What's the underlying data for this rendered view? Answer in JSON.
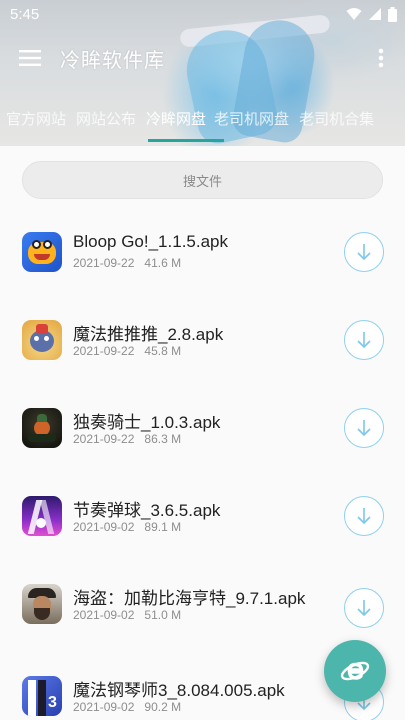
{
  "status_bar": {
    "time": "5:45"
  },
  "app": {
    "title": "冷眸软件库"
  },
  "tabs": [
    "官方网站",
    "网站公布",
    "冷眸网盘",
    "老司机网盘",
    "老司机合集"
  ],
  "active_tab": "冷眸网盘",
  "search": {
    "placeholder": "搜文件"
  },
  "files": [
    {
      "name": "Bloop Go!_1.1.5.apk",
      "date": "2021-09-22",
      "size": "41.6 M",
      "icon": "bloop-go-app-icon"
    },
    {
      "name": "魔法推推推_2.8.apk",
      "date": "2021-09-22",
      "size": "45.8 M",
      "icon": "magic-push-app-icon"
    },
    {
      "name": "独奏骑士_1.0.3.apk",
      "date": "2021-09-22",
      "size": "86.3 M",
      "icon": "solo-knight-app-icon"
    },
    {
      "name": "节奏弹球_3.6.5.apk",
      "date": "2021-09-02",
      "size": "89.1 M",
      "icon": "rhythm-ball-app-icon"
    },
    {
      "name": "海盗：加勒比海亨特_9.7.1.apk",
      "date": "2021-09-02",
      "size": "51.0 M",
      "icon": "pirate-hunter-app-icon"
    },
    {
      "name": "魔法钢琴师3_8.084.005.apk",
      "date": "2021-09-02",
      "size": "90.2 M",
      "icon": "magic-piano-app-icon"
    }
  ],
  "colors": {
    "accent": "#26a69a",
    "fab": "#4db6ac",
    "download_ring": "#8fd0ee"
  }
}
